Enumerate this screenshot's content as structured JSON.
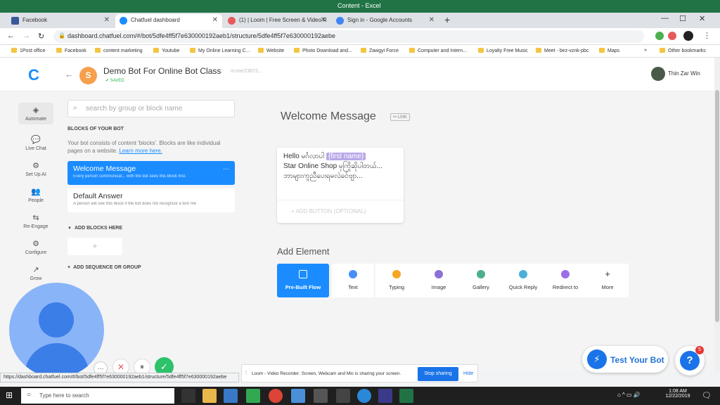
{
  "window": {
    "title": "Content - Excel"
  },
  "tabs": [
    {
      "label": "Facebook",
      "color": "#3b5998"
    },
    {
      "label": "Chatfuel dashboard",
      "color": "#1a8cff",
      "active": true
    },
    {
      "label": "(1) | Loom | Free Screen & Video R",
      "color": "#e55b5b"
    },
    {
      "label": "Sign in - Google Accounts",
      "color": "#4285f4"
    }
  ],
  "address": {
    "url": "dashboard.chatfuel.com/#/bot/5dfe4ff5f7e630000192aeb1/structure/5dfe4ff5f7e630000192aebe"
  },
  "bookmarks": [
    "1Post office",
    "Facebook",
    "content marketing",
    "Youtube",
    "My Online Learning C...",
    "Website",
    "Photo Download and...",
    "Zawgyi Force",
    "Computer and Intern...",
    "Loyalty Free Music",
    "Meet - bez-vznk-pbc",
    "Maps",
    "Other bookmarks"
  ],
  "bookmarks_overflow": "»",
  "header": {
    "logo": "C",
    "avatar_letter": "S",
    "bot_name": "Demo Bot For Online Bot Class",
    "saved": "✔ SAVED",
    "mme_link": "m.me/23672...",
    "user_name": "Thin Zar Win"
  },
  "sidebar": [
    {
      "label": "Automate",
      "icon": "◈"
    },
    {
      "label": "Live Chat",
      "icon": "💬"
    },
    {
      "label": "Set Up AI",
      "icon": "⚙"
    },
    {
      "label": "People",
      "icon": "👥"
    },
    {
      "label": "Re-Engage",
      "icon": "⇆"
    },
    {
      "label": "Configure",
      "icon": "⚙"
    },
    {
      "label": "Grow",
      "icon": "↗"
    }
  ],
  "blocks_panel": {
    "search_placeholder": "search by group or block name",
    "section_title": "BLOCKS OF YOUR BOT",
    "description": "Your bot consists of content 'blocks'. Blocks are like individual pages on a website.",
    "learn_more": "Learn more here.",
    "blocks": [
      {
        "title": "Welcome Message",
        "subtitle": "Every person communicat... with the bot sees this block first.",
        "more": "···"
      },
      {
        "title": "Default Answer",
        "subtitle": "A person will see this block if the bot does not recognize a text me"
      }
    ],
    "add_blocks": "ADD BLOCKS HERE",
    "add_sequence": "ADD SEQUENCE OR GROUP"
  },
  "main": {
    "title": "Welcome Message",
    "link_label": "LINK",
    "card_line1": "Hello မင်္ဂလာပါ",
    "card_pill": "{first name}",
    "card_line2": "Star Online Shop မှကြိုဆိုပါတယ်...",
    "card_line3": "ဘာများကူညီပေးရမလဲခင်ဗျာ...",
    "add_button": "ADD BUTTON (OPTIONAL)",
    "add_element": "Add Element",
    "elements": [
      {
        "label": "Pre-Built Flow",
        "color": "#ffffff"
      },
      {
        "label": "Text",
        "color": "#4b8df8"
      },
      {
        "label": "Typing",
        "color": "#f5a623"
      },
      {
        "label": "Image",
        "color": "#8e6fd8"
      },
      {
        "label": "Gallery",
        "color": "#4caf8f"
      },
      {
        "label": "Quick Reply",
        "color": "#4bb0d8"
      },
      {
        "label": "Redirect to",
        "color": "#9b6ee8"
      },
      {
        "label": "More",
        "color": "#333333"
      }
    ]
  },
  "status_url": "https://dashboard.chatfuel.com/#/bot/5dfe4ff5f7e630000192aeb1/structure/5dfe4ff5f7e630000192aebe",
  "loom": {
    "text": "Loom - Video Recorder: Screen, Webcam and Mic is sharing your screen.",
    "stop": "Stop sharing",
    "hide": "Hide"
  },
  "test_bot": "Test Your Bot",
  "help_badge": "5",
  "taskbar": {
    "search": "Type here to search",
    "time": "1:08 AM",
    "date": "12/22/2019"
  }
}
